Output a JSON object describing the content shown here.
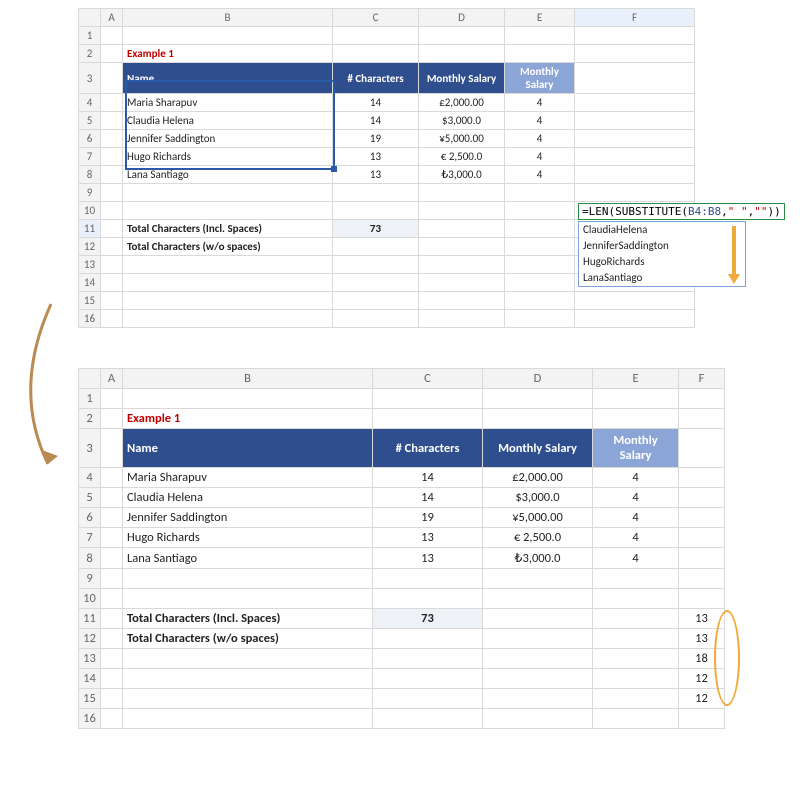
{
  "top": {
    "columns": [
      "A",
      "B",
      "C",
      "D",
      "E",
      "F"
    ],
    "rows": [
      "1",
      "2",
      "3",
      "4",
      "5",
      "6",
      "7",
      "8",
      "9",
      "10",
      "11",
      "12",
      "13",
      "14",
      "15",
      "16"
    ],
    "example_label": "Example 1",
    "headers": {
      "name": "Name",
      "chars": "# Characters",
      "msal1": "Monthly Salary",
      "msal2": "Monthly Salary"
    },
    "data": [
      {
        "name": "Maria Sharapuv",
        "chars": "14",
        "sal": "£2,000.00",
        "m": "4"
      },
      {
        "name": "Claudia Helena",
        "chars": "14",
        "sal": "$3,000.0",
        "m": "4"
      },
      {
        "name": "Jennifer Saddington",
        "chars": "19",
        "sal": "¥5,000.00",
        "m": "4"
      },
      {
        "name": "Hugo Richards",
        "chars": "13",
        "sal": "€ 2,500.0",
        "m": "4"
      },
      {
        "name": "Lana Santiago",
        "chars": "13",
        "sal": "₺3,000.0",
        "m": "4"
      }
    ],
    "totals": {
      "incl_label": "Total Characters (Incl. Spaces)",
      "incl_val": "73",
      "wo_label": "Total Characters (w/o spaces)"
    },
    "formula_parts": {
      "p1": "=LEN(SUBSTITUTE(",
      "ref": "B4:B8",
      "p2": ",",
      "s1": "\" \"",
      "p3": ",",
      "s2": "\"\"",
      "p4": "))"
    },
    "spill": [
      "ClaudiaHelena",
      "JenniferSaddington",
      "HugoRichards",
      "LanaSantiago"
    ]
  },
  "bottom": {
    "columns": [
      "A",
      "B",
      "C",
      "D",
      "E",
      "F"
    ],
    "rows": [
      "1",
      "2",
      "3",
      "4",
      "5",
      "6",
      "7",
      "8",
      "9",
      "10",
      "11",
      "12",
      "13",
      "14",
      "15",
      "16"
    ],
    "example_label": "Example 1",
    "headers": {
      "name": "Name",
      "chars": "# Characters",
      "msal1": "Monthly Salary",
      "msal2": "Monthly Salary"
    },
    "data": [
      {
        "name": "Maria Sharapuv",
        "chars": "14",
        "sal": "£2,000.00",
        "m": "4"
      },
      {
        "name": "Claudia Helena",
        "chars": "14",
        "sal": "$3,000.0",
        "m": "4"
      },
      {
        "name": "Jennifer Saddington",
        "chars": "19",
        "sal": "¥5,000.00",
        "m": "4"
      },
      {
        "name": "Hugo Richards",
        "chars": "13",
        "sal": "€ 2,500.0",
        "m": "4"
      },
      {
        "name": "Lana Santiago",
        "chars": "13",
        "sal": "₺3,000.0",
        "m": "4"
      }
    ],
    "totals": {
      "incl_label": "Total Characters (Incl. Spaces)",
      "incl_val": "73",
      "wo_label": "Total Characters (w/o spaces)"
    },
    "fvals": [
      "13",
      "13",
      "18",
      "12",
      "12"
    ]
  }
}
